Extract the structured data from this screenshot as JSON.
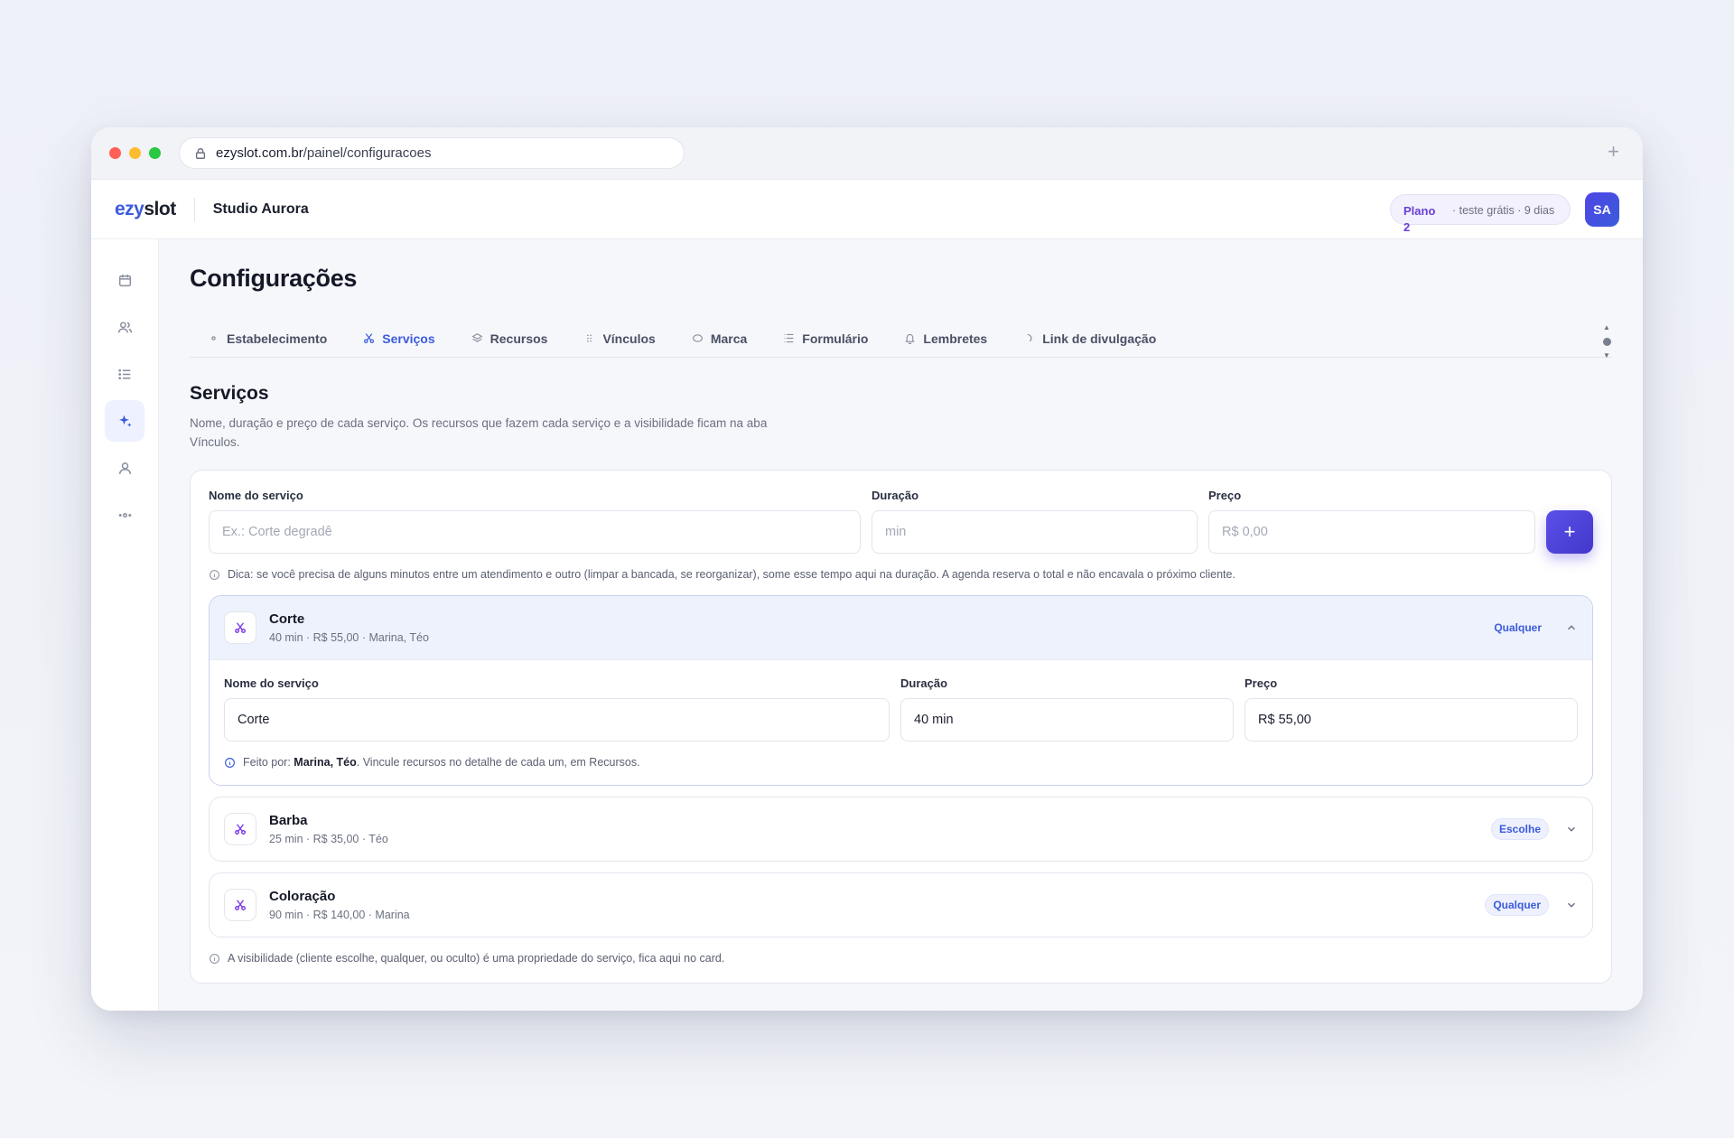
{
  "browser": {
    "url_host": "ezyslot.com.br",
    "url_path": "/painel/configuracoes",
    "new_tab": "+"
  },
  "topbar": {
    "logo_a": "ezy",
    "logo_b": "slot",
    "studio": "Studio Aurora",
    "plan_name": "Plano 2",
    "plan_trial": "· teste grátis · 9 dias",
    "avatar": "SA"
  },
  "sidebar": {
    "items": [
      {
        "icon": "calendar-icon"
      },
      {
        "icon": "users-icon"
      },
      {
        "icon": "list-icon"
      },
      {
        "icon": "sparkle-icon",
        "active": true
      },
      {
        "icon": "user-icon"
      },
      {
        "icon": "settings-icon"
      }
    ]
  },
  "page": {
    "title": "Configurações",
    "tabs": [
      {
        "label": "Estabelecimento",
        "icon": "dot-icon"
      },
      {
        "label": "Serviços",
        "icon": "scissors-icon",
        "active": true
      },
      {
        "label": "Recursos",
        "icon": "layers-icon"
      },
      {
        "label": "Vínculos",
        "icon": "grip-icon"
      },
      {
        "label": "Marca",
        "icon": "ellipse-icon"
      },
      {
        "label": "Formulário",
        "icon": "form-icon"
      },
      {
        "label": "Lembretes",
        "icon": "bell-icon"
      },
      {
        "label": "Link de divulgação",
        "icon": "link-icon"
      }
    ]
  },
  "services": {
    "title": "Serviços",
    "description": "Nome, duração e preço de cada serviço. Os recursos que fazem cada serviço e a visibilidade ficam na aba Vínculos.",
    "new_form": {
      "name_label": "Nome do serviço",
      "name_placeholder": "Ex.: Corte degradê",
      "duration_label": "Duração",
      "duration_placeholder": "min",
      "price_label": "Preço",
      "price_placeholder": "R$ 0,00",
      "add_label": "+"
    },
    "tip": "Dica: se você precisa de alguns minutos entre um atendimento e outro (limpar a bancada, se reorganizar), some esse tempo aqui na duração. A agenda reserva o total e não encavala o próximo cliente.",
    "list": [
      {
        "name": "Corte",
        "meta": "40 min · R$ 55,00 · Marina, Téo",
        "visibility": "Qualquer",
        "open": true,
        "detail": {
          "name_label": "Nome do serviço",
          "name_value": "Corte",
          "duration_label": "Duração",
          "duration_value": "40 min",
          "price_label": "Preço",
          "price_value": "R$ 55,00",
          "footer_prefix": "Feito por: ",
          "footer_people": "Marina, Téo",
          "footer_suffix": ". Vincule recursos no detalhe de cada um, em Recursos."
        }
      },
      {
        "name": "Barba",
        "meta": "25 min · R$ 35,00 · Téo",
        "visibility": "Escolhe"
      },
      {
        "name": "Coloração",
        "meta": "90 min · R$ 140,00 · Marina",
        "visibility": "Qualquer"
      }
    ],
    "footer_tip": "A visibilidade (cliente escolhe, qualquer, ou oculto) é uma propriedade do serviço, fica aqui no card."
  }
}
